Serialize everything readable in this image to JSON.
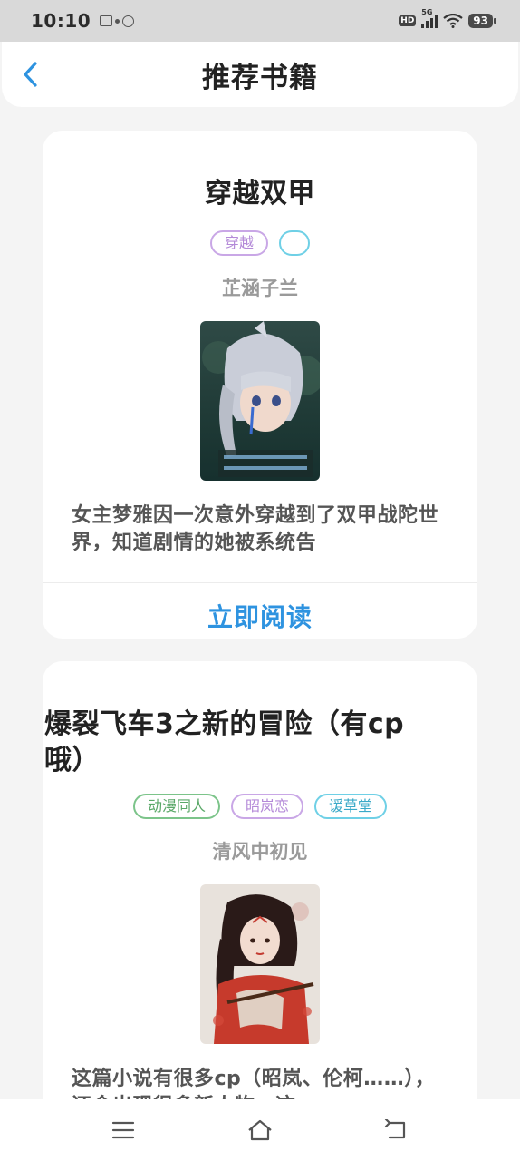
{
  "status_bar": {
    "time": "10:10",
    "battery": "93",
    "network": "5G",
    "hd_label": "HD"
  },
  "header": {
    "title": "推荐书籍",
    "back_icon": "chevron-left-icon"
  },
  "books": [
    {
      "title": "穿越双甲",
      "tags": [
        {
          "label": "穿越",
          "color": "#b48ad8"
        },
        {
          "label": "",
          "color": "#3aa9c8"
        }
      ],
      "author": "芷涵子兰",
      "description": "女主梦雅因一次意外穿越到了双甲战陀世界，知道剧情的她被系统告",
      "read_label": "立即阅读"
    },
    {
      "title": "爆裂飞车3之新的冒险（有cp哦）",
      "tags": [
        {
          "label": "动漫同人",
          "color": "#5aa868"
        },
        {
          "label": "昭岚恋",
          "color": "#b48ad8"
        },
        {
          "label": "谖草堂",
          "color": "#3aa9c8"
        }
      ],
      "author": "清风中初见",
      "description": "这篇小说有很多cp（昭岚、伦柯……），还会出现很多新人物，这"
    }
  ],
  "nav_bar": {
    "menu_icon": "menu-icon",
    "home_icon": "home-icon",
    "back_icon": "return-icon"
  },
  "colors": {
    "accent": "#2e93e0",
    "background": "#f4f4f4"
  }
}
